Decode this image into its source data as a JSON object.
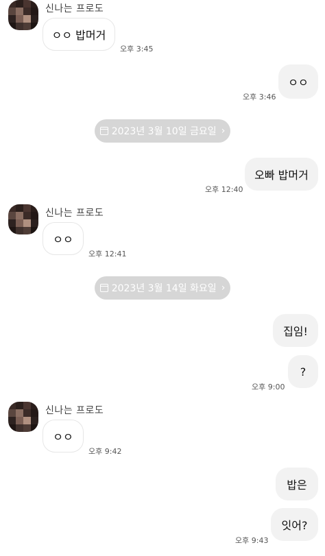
{
  "contact_name": "신나는 프로도",
  "messages": [
    {
      "text": "ㅇㅇ 밥머거",
      "time": "오후 3:45"
    },
    {
      "text": "ㅇㅇ",
      "time": "오후 3:46"
    },
    {
      "text": "오빠 밥머거",
      "time": "오후 12:40"
    },
    {
      "text": "ㅇㅇ",
      "time": "오후 12:41"
    },
    {
      "text": "집임!"
    },
    {
      "text": "?",
      "time": "오후 9:00"
    },
    {
      "text": "ㅇㅇ",
      "time": "오후 9:42"
    },
    {
      "text": "밥은"
    },
    {
      "text": "잇어?",
      "time": "오후 9:43"
    }
  ],
  "date_dividers": [
    {
      "label": "2023년 3월 10일 금요일",
      "icon": "calendar-icon",
      "chevron": "›"
    },
    {
      "label": "2023년 3월 14일 화요일",
      "icon": "calendar-icon",
      "chevron": "›"
    }
  ],
  "colors": {
    "background": "#ffffff",
    "my_bubble": "#f2f2f2",
    "their_bubble": "#ffffff",
    "date_pill": "#d6d6d6"
  }
}
